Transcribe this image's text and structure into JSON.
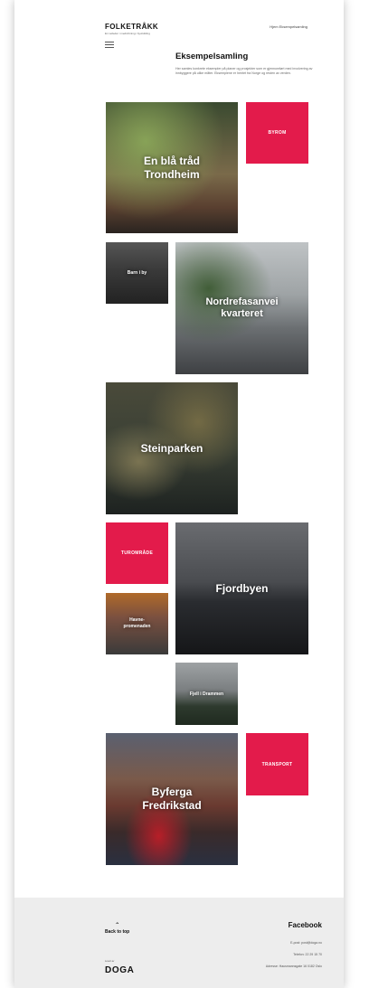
{
  "header": {
    "brand": "FOLKETRÅKK",
    "brand_sub": "En veileder i medvirkning i byutvikling",
    "breadcrumb": "Hjem  Eksempelsamling"
  },
  "page": {
    "title": "Eksempelsamling",
    "intro": "Her samles konkrete eksempler på planer og prosjekter som er gjennomført med involvering av innbyggere på ulike måter. Eksemplene er hentet fra Norge og resten av verden."
  },
  "tiles": {
    "trondheim": "En blå tråd Trondheim",
    "byrom": "BYROM",
    "barn": "Barn i by",
    "nordre": "Nordrefasanvei kvarteret",
    "stein": "Steinparken",
    "turomrade": "TUROMRÅDE",
    "fjordbyen": "Fjordbyen",
    "havne": "Havne-promenaden",
    "fjell": "Fjell i Drammen",
    "byferga": "Byferga Fredrikstad",
    "transport": "TRANSPORT"
  },
  "footer": {
    "back_to_top": "Back to top",
    "logo_small": "Levert av",
    "logo": "DOGA",
    "social": "Facebook",
    "email": "E-post: post@doga.no",
    "phone": "Telefon: 22 29 15 70",
    "address": "Adresse: Hausmannsgate 16 0182 Oslo"
  },
  "colors": {
    "accent": "#e31b4b",
    "footer_bg": "#ededed"
  }
}
